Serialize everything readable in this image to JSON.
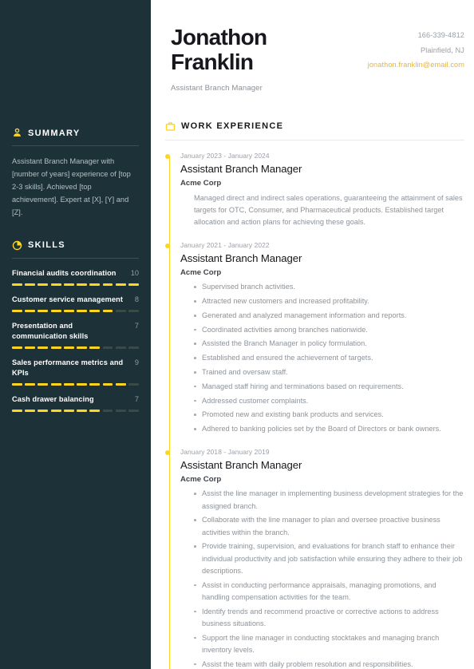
{
  "colors": {
    "sidebar_bg": "#1c3138",
    "accent": "#ffd524",
    "email_link": "#e8b437",
    "page_bg": "#ffffff"
  },
  "header": {
    "first_name": "Jonathon",
    "last_name": "Franklin",
    "role": "Assistant Branch Manager",
    "phone": "166-339-4812",
    "location": "Plainfield, NJ",
    "email": "jonathon.franklin@email.com"
  },
  "sidebar": {
    "summary": {
      "icon": "user-icon",
      "title": "SUMMARY",
      "text": "Assistant Branch Manager with [number of years] experience of [top 2-3 skills]. Achieved [top achievement]. Expert at [X], [Y] and [Z]."
    },
    "skills": {
      "icon": "pie-chart-icon",
      "title": "SKILLS",
      "max": 10,
      "items": [
        {
          "name": "Financial audits coordination",
          "value": 10
        },
        {
          "name": "Customer service management",
          "value": 8
        },
        {
          "name": "Presentation and communication skills",
          "value": 7
        },
        {
          "name": "Sales performance metrics and KPIs",
          "value": 9
        },
        {
          "name": "Cash drawer balancing",
          "value": 7
        }
      ]
    }
  },
  "work_experience": {
    "icon": "briefcase-icon",
    "title": "WORK EXPERIENCE",
    "jobs": [
      {
        "date": "January 2023 - January 2024",
        "title": "Assistant Branch Manager",
        "company": "Acme Corp",
        "description": "Managed direct and indirect sales operations, guaranteeing the attainment of sales targets for OTC, Consumer, and Pharmaceutical products. Established target allocation and action plans for achieving these goals.",
        "bullets": []
      },
      {
        "date": "January 2021 - January 2022",
        "title": "Assistant Branch Manager",
        "company": "Acme Corp",
        "description": "",
        "bullets": [
          "Supervised branch activities.",
          "Attracted new customers and increased profitability.",
          "Generated and analyzed management information and reports.",
          "Coordinated activities among branches nationwide.",
          "Assisted the Branch Manager in policy formulation.",
          "Established and ensured the achievement of targets.",
          "Trained and oversaw staff.",
          "Managed staff hiring and terminations based on requirements.",
          "Addressed customer complaints.",
          "Promoted new and existing bank products and services.",
          "Adhered to banking policies set by the Board of Directors or bank owners."
        ]
      },
      {
        "date": "January 2018 - January 2019",
        "title": "Assistant Branch Manager",
        "company": "Acme Corp",
        "description": "",
        "bullets": [
          "Assist the line manager in implementing business development strategies for the assigned branch.",
          "Collaborate with the line manager to plan and oversee proactive business activities within the branch.",
          "Provide training, supervision, and evaluations for branch staff to enhance their individual productivity and job satisfaction while ensuring they adhere to their job descriptions.",
          "Assist in conducting performance appraisals, managing promotions, and handling compensation activities for the team.",
          "Identify trends and recommend proactive or corrective actions to address business situations.",
          "Support the line manager in conducting stocktakes and managing branch inventory levels.",
          "Assist the team with daily problem resolution and responsibilities."
        ]
      }
    ]
  }
}
